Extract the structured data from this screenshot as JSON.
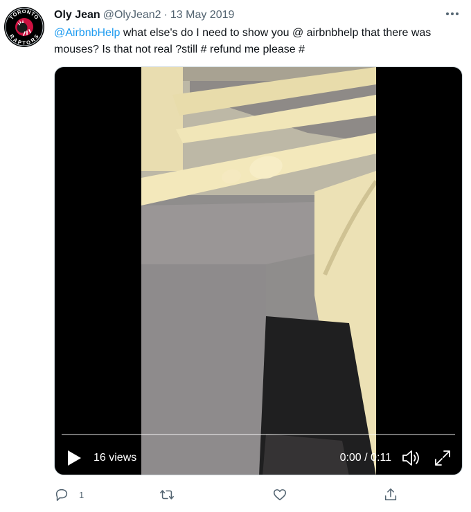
{
  "user": {
    "display_name": "Oly Jean",
    "handle": "@OlyJean2",
    "separator": "·",
    "date": "13 May 2019",
    "avatar": "toronto-raptors-logo",
    "avatar_text_top": "TORONTO",
    "avatar_text_bottom": "RAPTORS"
  },
  "tweet": {
    "mention": "@AirbnbHelp",
    "text": "  what else's do I need to show you @ airbnbhelp that there was mouses? Is that not real ?still # refund me please #"
  },
  "video": {
    "views": "16 views",
    "time": "0:00 / 0:11",
    "progress": 0,
    "play_icon": "play-icon",
    "volume_icon": "volume-icon",
    "fullscreen_icon": "fullscreen-icon"
  },
  "actions": {
    "reply_count": "1",
    "retweet_count": "",
    "like_count": ""
  },
  "colors": {
    "link": "#1d9bf0",
    "secondary_text": "#536471",
    "icon": "#536471"
  }
}
